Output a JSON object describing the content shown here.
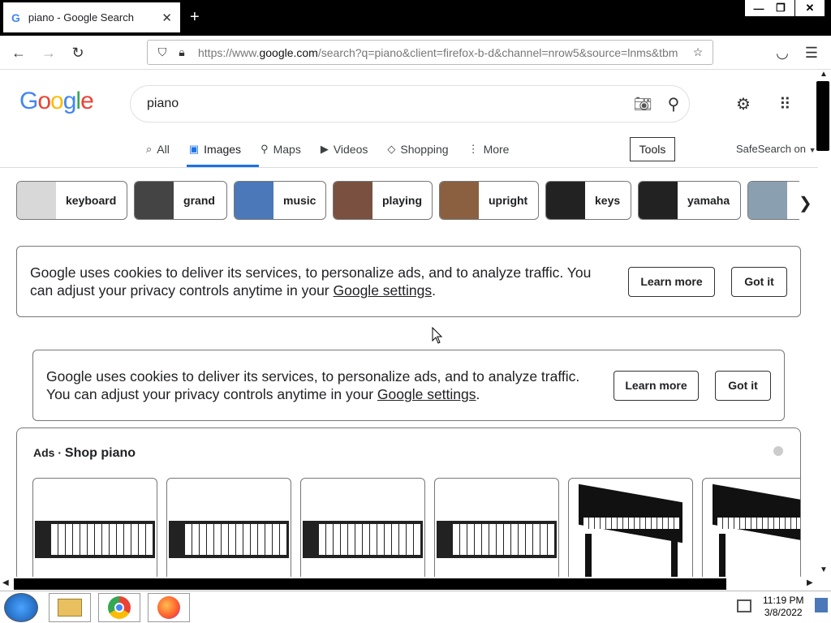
{
  "browser": {
    "tab_title": "piano - Google Search",
    "tab_favicon": "G",
    "new_tab_glyph": "+",
    "url_prefix": "https://www.",
    "url_domain": "google.com",
    "url_rest": "/search?q=piano&client=firefox-b-d&channel=nrow5&source=lnms&tbm",
    "window_controls": [
      "minimize-icon",
      "restore-icon",
      "close-icon"
    ]
  },
  "search": {
    "logo": "Google",
    "query": "piano"
  },
  "tabs": [
    {
      "label": "All",
      "icon": "search-icon",
      "glyph": "⌕"
    },
    {
      "label": "Images",
      "icon": "images-icon",
      "glyph": "▣"
    },
    {
      "label": "Maps",
      "icon": "map-pin-icon",
      "glyph": "⚲"
    },
    {
      "label": "Videos",
      "icon": "video-icon",
      "glyph": "▶"
    },
    {
      "label": "Shopping",
      "icon": "tag-icon",
      "glyph": "◇"
    },
    {
      "label": "More",
      "icon": "more-vert-icon",
      "glyph": "⋮"
    }
  ],
  "active_tab": "Images",
  "tools_label": "Tools",
  "safesearch_label": "SafeSearch on",
  "chips": [
    {
      "label": "keyboard",
      "color": "#d8d8d8"
    },
    {
      "label": "grand",
      "color": "#444444"
    },
    {
      "label": "music",
      "color": "#4a78b8"
    },
    {
      "label": "playing",
      "color": "#7a5040"
    },
    {
      "label": "upright",
      "color": "#8a6040"
    },
    {
      "label": "keys",
      "color": "#222222"
    },
    {
      "label": "yamaha",
      "color": "#222222"
    },
    {
      "label": "",
      "color": "#8aa0b0"
    }
  ],
  "cookie1": {
    "text": "Google uses cookies to deliver its services, to personalize ads, and to analyze traffic. You can adjust your privacy controls anytime in your ",
    "link": "Google settings",
    "end": ".",
    "learn_more": "Learn more",
    "got_it": "Got it"
  },
  "cookie2": {
    "text": "Google uses cookies to deliver its services, to personalize ads, and to analyze traffic. You can adjust your privacy controls anytime in your ",
    "link": "Google settings",
    "end": ".",
    "learn_more": "Learn more",
    "got_it": "Got it"
  },
  "ads": {
    "label": "Ads",
    "separator": "·",
    "title": "Shop piano",
    "products": [
      "keyboard-controller",
      "keyboard-controller",
      "digital-keyboard",
      "keyboard-controller",
      "digital-piano",
      "digital-piano"
    ]
  },
  "taskbar": {
    "time": "11:19 PM",
    "date": "3/8/2022",
    "apps": [
      "windows-start-icon",
      "file-explorer-icon",
      "chrome-icon",
      "firefox-icon"
    ]
  },
  "colors": {
    "google_blue": "#4285f4",
    "google_red": "#ea4335",
    "google_yellow": "#fbbc05",
    "google_green": "#34a853",
    "accent": "#1a73e8"
  }
}
